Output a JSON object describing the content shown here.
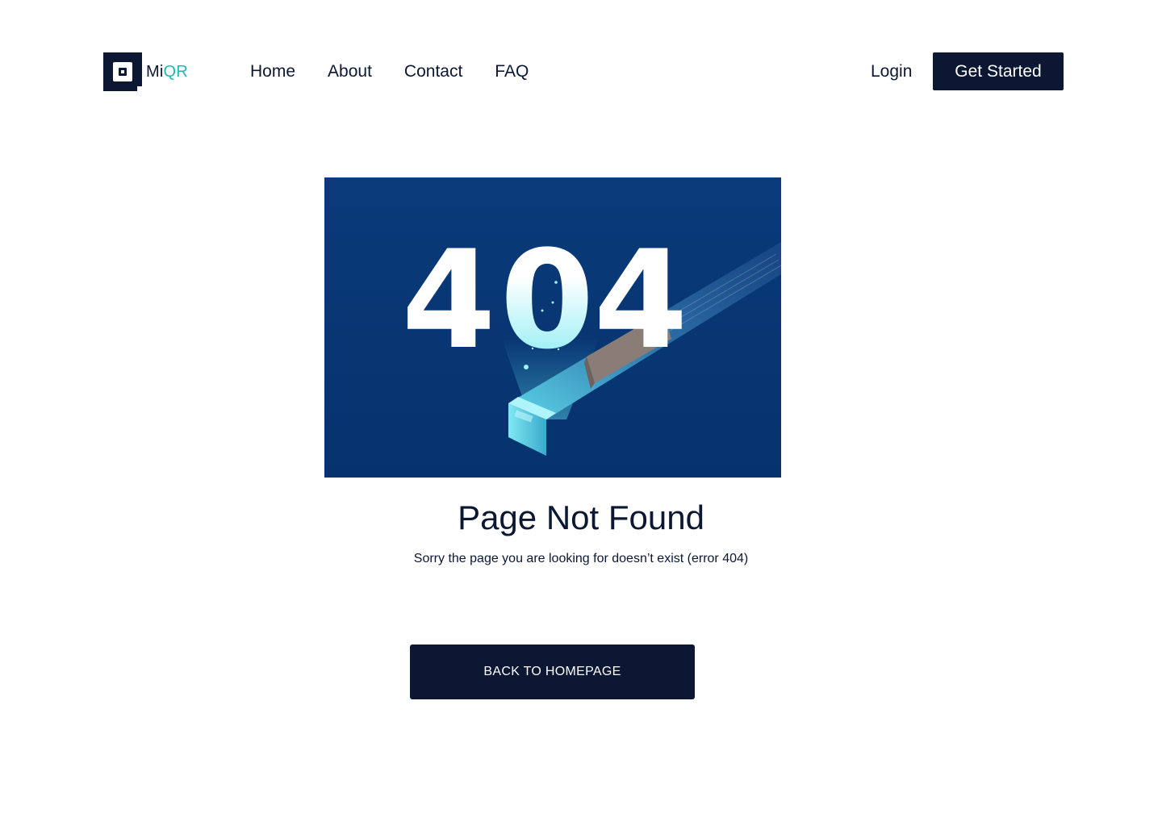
{
  "brand": {
    "name_part1": "Mi",
    "name_part2": "QR",
    "accent_color": "#1fb8b5",
    "primary_color": "#0b1733"
  },
  "nav": {
    "items": [
      {
        "label": "Home"
      },
      {
        "label": "About"
      },
      {
        "label": "Contact"
      },
      {
        "label": "FAQ"
      }
    ]
  },
  "header": {
    "login_label": "Login",
    "cta_label": "Get Started"
  },
  "hero": {
    "illustration_text": "404",
    "illustration_icon": "404-conveyor-illustration"
  },
  "content": {
    "title": "Page Not Found",
    "subtitle": "Sorry the page you are looking for doesn’t exist (error 404)",
    "button_label": "BACK TO HOMEPAGE"
  }
}
